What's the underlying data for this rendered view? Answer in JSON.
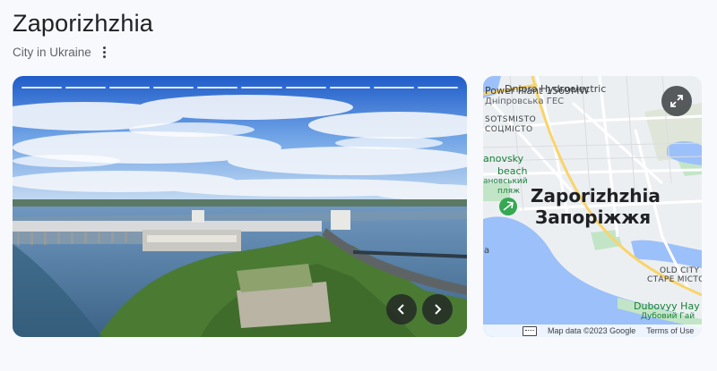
{
  "header": {
    "title": "Zaporizhzhia",
    "subtitle": "City in Ukraine"
  },
  "photo": {
    "progress_segments": 10,
    "prev_icon": "chevron-left-icon",
    "next_icon": "chevron-right-icon"
  },
  "map": {
    "labels": {
      "hydro_en_1": "Dnipro Hydroelectric",
      "hydro_en_2": "Power Plant 1569MW",
      "hydro_uk": "Дніпровська ГЕС",
      "sotsmisto_en": "SOTSMISTO",
      "sotsmisto_uk": "СОЦМІСТО",
      "beach_en_1": "anovsky",
      "beach_en_2": "beach",
      "beach_uk_1": "ановський",
      "beach_uk_2": "пляж",
      "city_en": "Zaporizhzhia",
      "city_uk": "Запоріжжя",
      "left_fragment": "a",
      "old_city_en": "OLD CITY",
      "old_city_uk": "СТАРЕ МІСТО",
      "dubovyy_en": "Dubovyy Hay",
      "dubovyy_uk": "Дубовий Гай"
    },
    "attribution": "Map data ©2023 Google",
    "terms": "Terms of Use",
    "colors": {
      "water": "#9cc0f9",
      "road_major": "#f9d46b",
      "park": "#c3e5c7",
      "pin": "#34a853"
    }
  }
}
